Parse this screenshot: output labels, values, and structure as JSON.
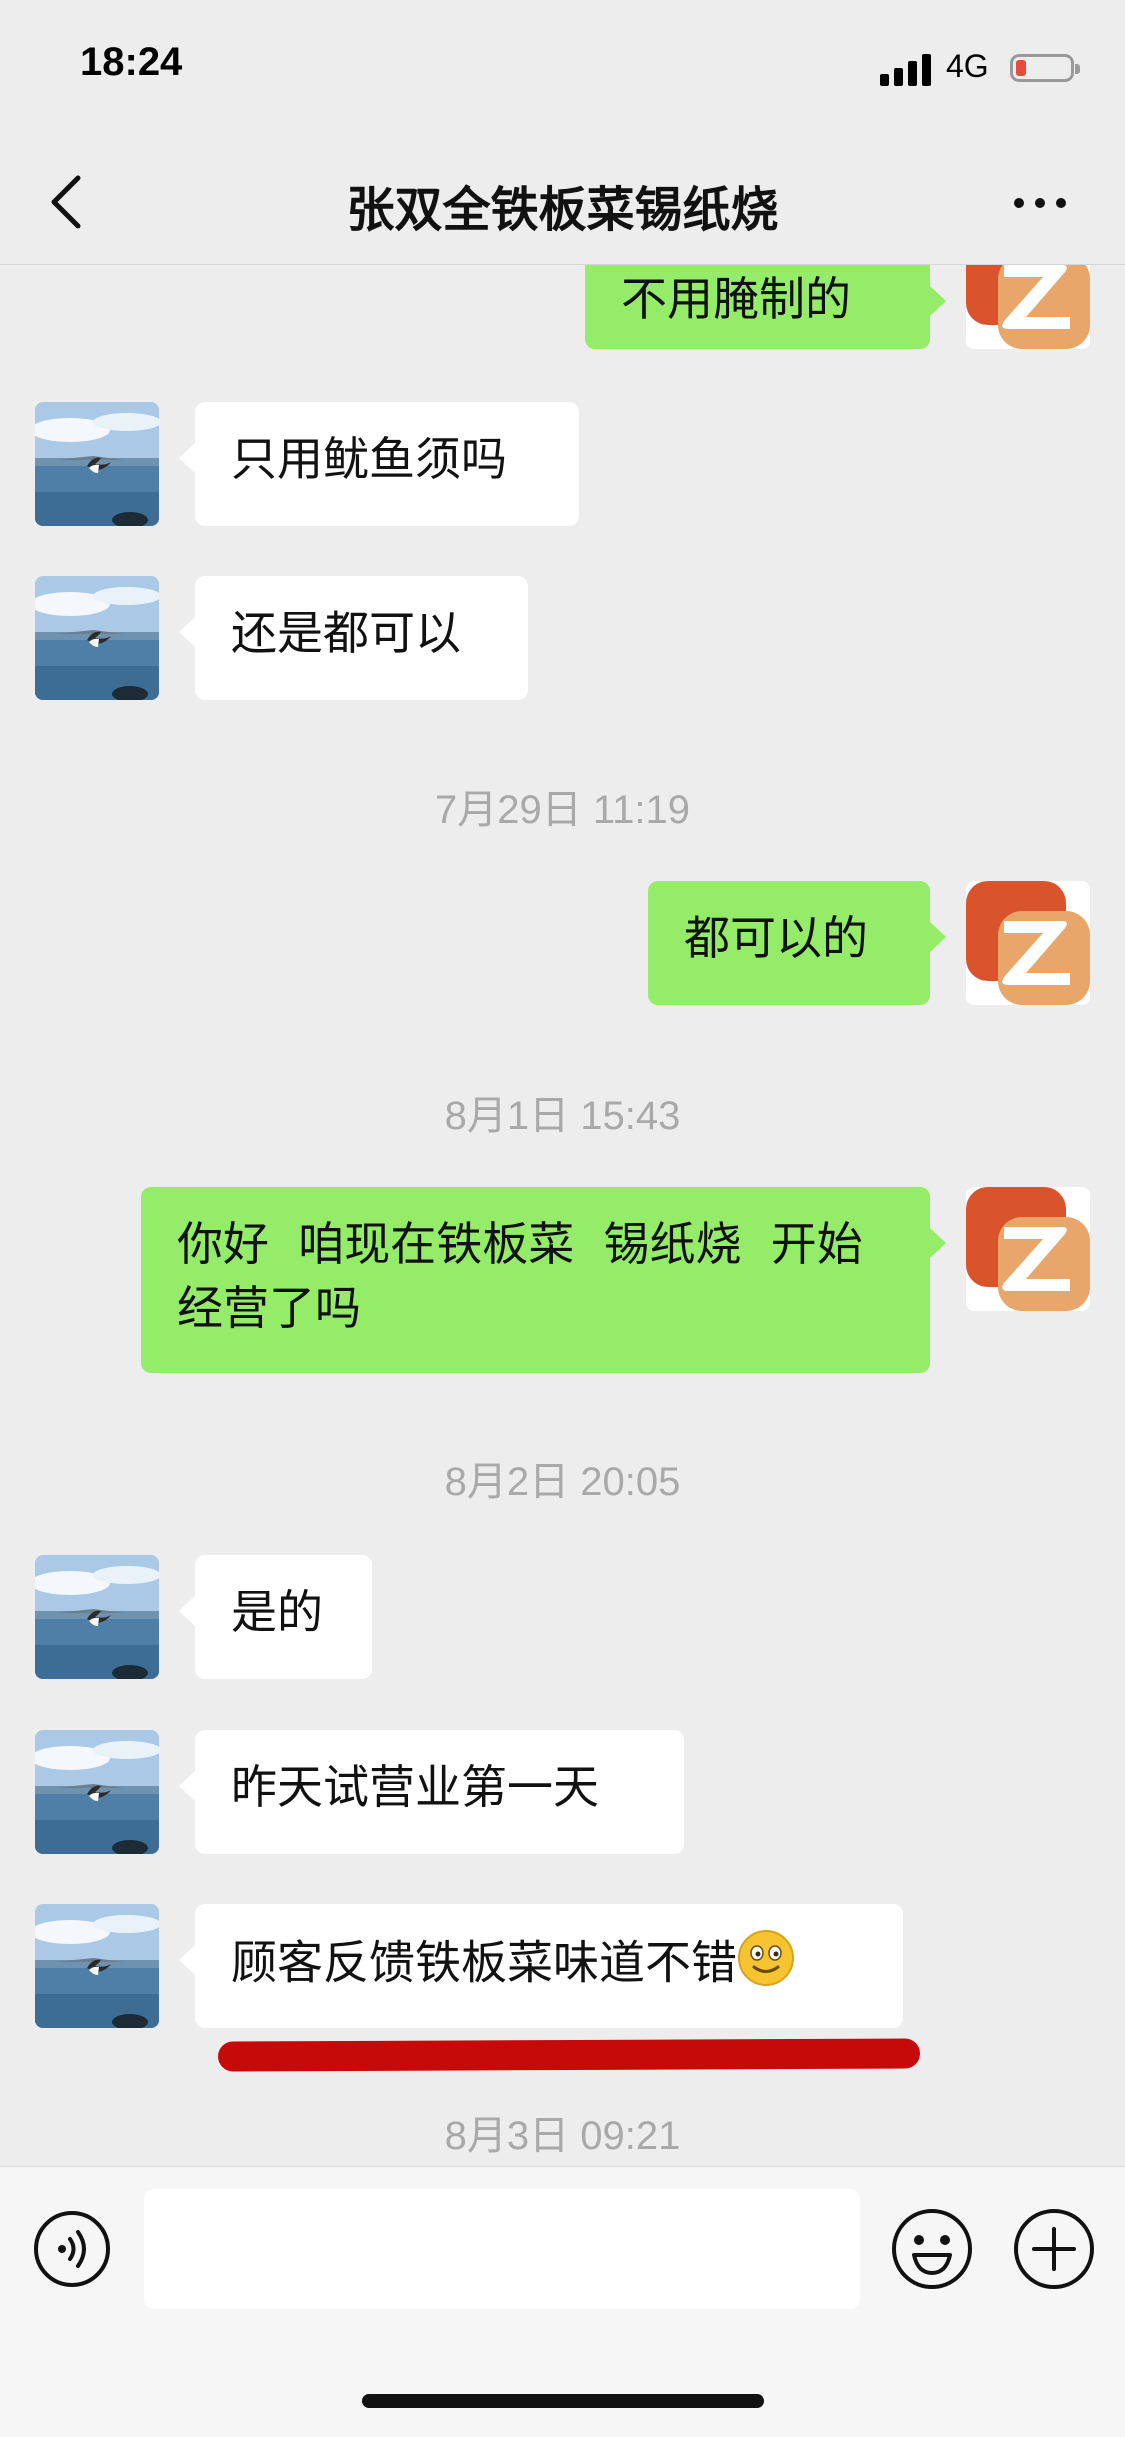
{
  "status_bar": {
    "time": "18:24",
    "network": "4G",
    "battery_color": "#e84b3c"
  },
  "nav": {
    "title": "张双全铁板菜锡纸烧"
  },
  "messages": [
    {
      "side": "out",
      "text": "不用腌制的"
    },
    {
      "side": "in",
      "text": "只用鱿鱼须吗"
    },
    {
      "side": "in",
      "text": "还是都可以"
    },
    {
      "type": "timestamp",
      "text": "7月29日 11:19"
    },
    {
      "side": "out",
      "text": "都可以的"
    },
    {
      "type": "timestamp",
      "text": "8月1日 15:43"
    },
    {
      "side": "out",
      "text": "你好  咱现在铁板菜  锡纸烧  开始经营了吗"
    },
    {
      "type": "timestamp",
      "text": "8月2日 20:05"
    },
    {
      "side": "in",
      "text": "是的"
    },
    {
      "side": "in",
      "text": "昨天试营业第一天"
    },
    {
      "side": "in",
      "text": "顾客反馈铁板菜味道不错",
      "emoji": "smile-emoji"
    },
    {
      "type": "timestamp",
      "text": "8月3日 09:21"
    }
  ],
  "annotation": {
    "underline_color": "#c60a0a"
  },
  "colors": {
    "outgoing_bubble": "#95ec69",
    "incoming_bubble": "#ffffff",
    "background": "#ededed",
    "logo_orange": "#e05a2b"
  },
  "input_bar": {
    "text_value": ""
  },
  "icons": {
    "back": "chevron-left-icon",
    "more": "more-dots-icon",
    "voice": "voice-icon",
    "emoji": "emoji-icon",
    "plus": "plus-icon"
  }
}
